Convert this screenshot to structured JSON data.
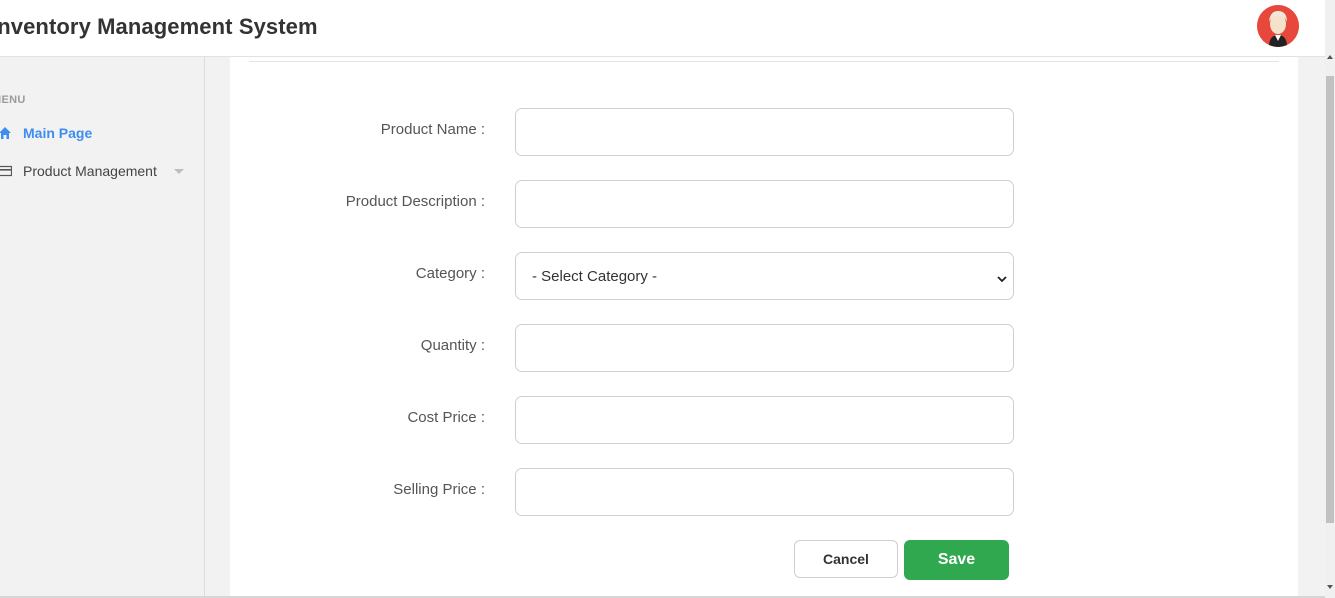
{
  "header": {
    "title": "Inventory Management System",
    "avatar_icon": "user-avatar-icon"
  },
  "sidebar": {
    "menu_header": "MENU",
    "items": [
      {
        "label": "Main Page",
        "icon": "home-icon",
        "active": true
      },
      {
        "label": "Product Management",
        "icon": "card-icon",
        "active": false,
        "expandable": true
      }
    ]
  },
  "form": {
    "fields": [
      {
        "label": "Product Name :",
        "value": "",
        "type": "text"
      },
      {
        "label": "Product Description :",
        "value": "",
        "type": "text"
      },
      {
        "label": "Category :",
        "value": "- Select Category -",
        "type": "select"
      },
      {
        "label": "Quantity :",
        "value": "",
        "type": "text"
      },
      {
        "label": "Cost Price :",
        "value": "",
        "type": "text"
      },
      {
        "label": "Selling Price :",
        "value": "",
        "type": "text"
      }
    ],
    "cancel_label": "Cancel",
    "save_label": "Save"
  },
  "colors": {
    "accent": "#3d8ef0",
    "save_button": "#2fa84f",
    "avatar_bg": "#e8483c"
  }
}
